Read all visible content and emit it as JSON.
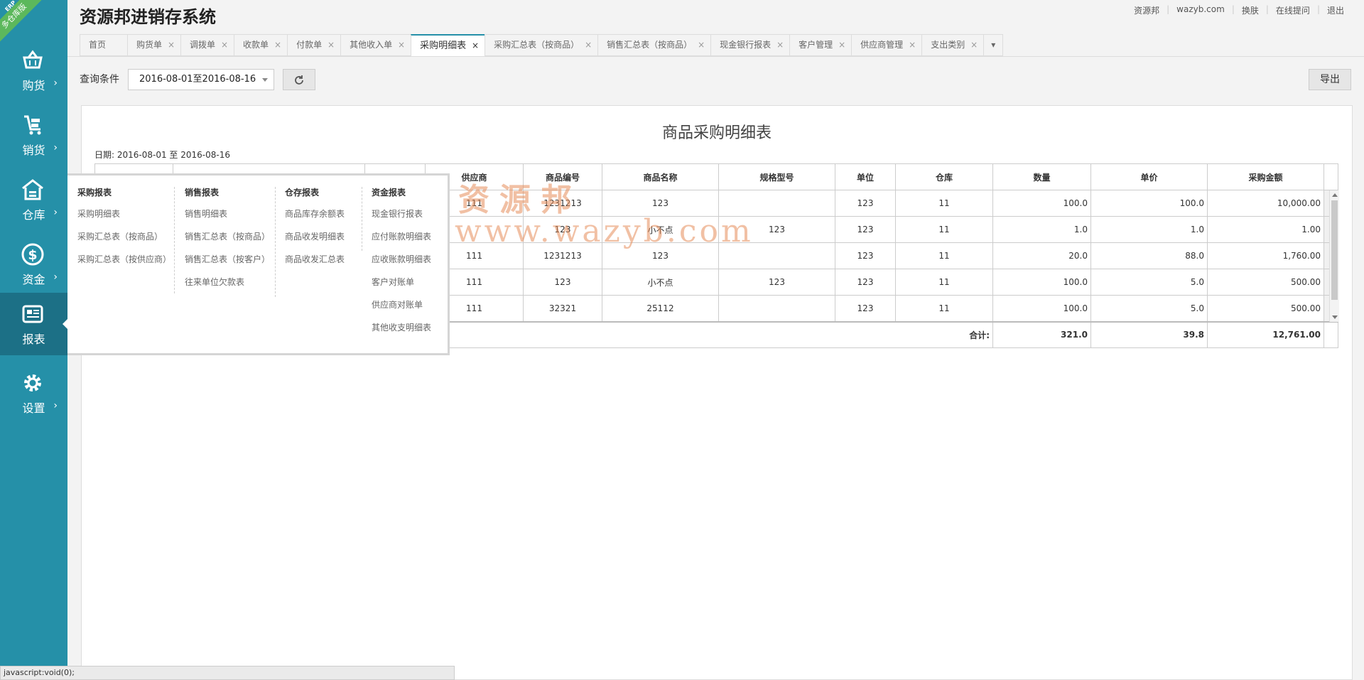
{
  "brand": {
    "erp_tag": "ERP",
    "badge": "多仓库版"
  },
  "app": {
    "title": "资源邦进销存系统"
  },
  "top_links": [
    "资源邦",
    "wazyb.com",
    "换肤",
    "在线提问",
    "退出"
  ],
  "sidebar": [
    {
      "label": "购货",
      "icon": "basket-icon"
    },
    {
      "label": "销货",
      "icon": "cart-icon"
    },
    {
      "label": "仓库",
      "icon": "warehouse-icon"
    },
    {
      "label": "资金",
      "icon": "dollar-icon"
    },
    {
      "label": "报表",
      "icon": "report-icon",
      "active": true
    },
    {
      "label": "设置",
      "icon": "gear-icon"
    }
  ],
  "tabs": [
    {
      "label": "首页",
      "closable": false
    },
    {
      "label": "购货单",
      "closable": true
    },
    {
      "label": "调拨单",
      "closable": true
    },
    {
      "label": "收款单",
      "closable": true
    },
    {
      "label": "付款单",
      "closable": true
    },
    {
      "label": "其他收入单",
      "closable": true
    },
    {
      "label": "采购明细表",
      "closable": true,
      "active": true
    },
    {
      "label": "采购汇总表（按商品）",
      "closable": true
    },
    {
      "label": "销售汇总表（按商品）",
      "closable": true
    },
    {
      "label": "现金银行报表",
      "closable": true
    },
    {
      "label": "客户管理",
      "closable": true
    },
    {
      "label": "供应商管理",
      "closable": true
    },
    {
      "label": "支出类别",
      "closable": true
    }
  ],
  "query": {
    "label": "查询条件",
    "date_range": "2016-08-01至2016-08-16",
    "export_label": "导出"
  },
  "report": {
    "title": "商品采购明细表",
    "date_line": "日期: 2016-08-01 至 2016-08-16",
    "columns": [
      "",
      "",
      "",
      "供应商",
      "商品编号",
      "商品名称",
      "规格型号",
      "单位",
      "仓库",
      "数量",
      "单价",
      "采购金额"
    ],
    "rows": [
      [
        "",
        "",
        "",
        "111",
        "1231213",
        "123",
        "",
        "123",
        "11",
        "100.0",
        "100.0",
        "10,000.00"
      ],
      [
        "",
        "",
        "",
        "",
        "123",
        "小不点",
        "123",
        "123",
        "11",
        "1.0",
        "1.0",
        "1.00"
      ],
      [
        "",
        "",
        "",
        "111",
        "1231213",
        "123",
        "",
        "123",
        "11",
        "20.0",
        "88.0",
        "1,760.00"
      ],
      [
        "",
        "",
        "",
        "111",
        "123",
        "小不点",
        "123",
        "123",
        "11",
        "100.0",
        "5.0",
        "500.00"
      ],
      [
        "",
        "",
        "",
        "111",
        "32321",
        "25112",
        "",
        "123",
        "11",
        "100.0",
        "5.0",
        "500.00"
      ]
    ],
    "total": {
      "label": "合计:",
      "qty": "321.0",
      "price": "39.8",
      "amount": "12,761.00"
    }
  },
  "watermark": {
    "line1": "资源邦",
    "line2": "www.wazyb.com"
  },
  "menu": {
    "columns": [
      {
        "heading": "采购报表",
        "items": [
          "采购明细表",
          "采购汇总表（按商品）",
          "采购汇总表（按供应商）"
        ]
      },
      {
        "heading": "销售报表",
        "items": [
          "销售明细表",
          "销售汇总表（按商品）",
          "销售汇总表（按客户）",
          "往来单位欠款表"
        ]
      },
      {
        "heading": "仓存报表",
        "items": [
          "商品库存余额表",
          "商品收发明细表",
          "商品收发汇总表"
        ]
      },
      {
        "heading": "资金报表",
        "items": [
          "现金银行报表",
          "应付账款明细表",
          "应收账款明细表",
          "客户对账单",
          "供应商对账单",
          "其他收支明细表"
        ]
      }
    ]
  },
  "status_bar": "javascript:void(0);",
  "colors": {
    "sidebar": "#2590a8",
    "sidebar_active": "#1c7086",
    "ribbon": "#5cb85c"
  }
}
